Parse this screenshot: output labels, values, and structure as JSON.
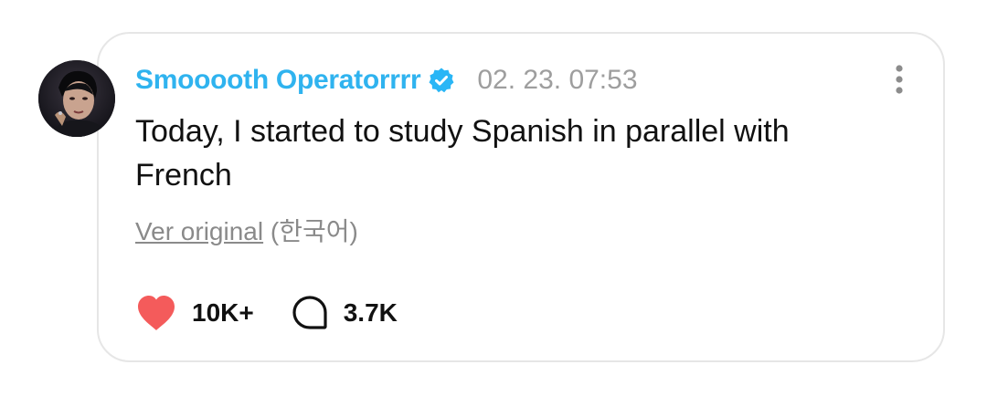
{
  "post": {
    "author": {
      "name": "Smooooth Operatorrrr",
      "verified": true,
      "avatar_icon": "profile-photo"
    },
    "timestamp": "02. 23. 07:53",
    "text": "Today, I started to study Spanish in parallel with French",
    "translation": {
      "link_label": "Ver original",
      "language_label": "(한국어)"
    },
    "actions": {
      "like_count": "10K+",
      "comment_count": "3.7K"
    }
  },
  "icons": {
    "verified": "verified-badge-icon",
    "more": "more-vertical-icon",
    "like": "heart-icon",
    "comment": "speech-bubble-icon"
  },
  "colors": {
    "username": "#2fb3ef",
    "verified_badge": "#29b6f6",
    "heart": "#f45b5b",
    "muted_text": "#9e9e9e",
    "card_border": "#e6e6e6"
  }
}
